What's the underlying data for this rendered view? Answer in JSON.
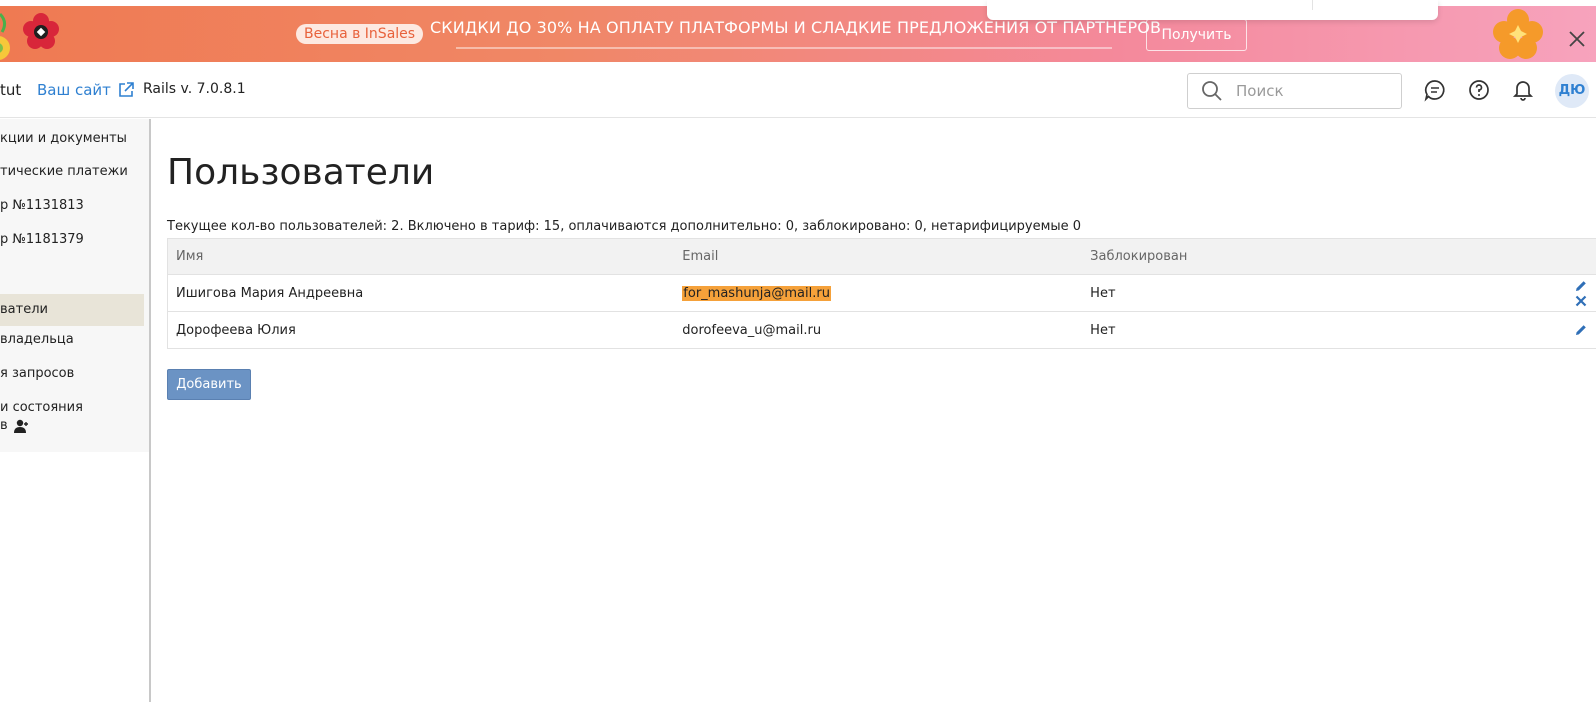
{
  "promo": {
    "badge": "Весна в InSales",
    "headline": "СКИДКИ ДО 30% НА ОПЛАТУ ПЛАТФОРМЫ И СЛАДКИЕ ПРЕДЛОЖЕНИЯ ОТ ПАРТНЕРОВ",
    "cta_label": "Получить"
  },
  "header": {
    "shop_name": "tut",
    "site_link_label": "Ваш сайт",
    "rails_version": "Rails v. 7.0.8.1",
    "search_placeholder": "Поиск",
    "avatar_initials": "ДЮ"
  },
  "sidebar": {
    "items": [
      {
        "label": "кции и документы",
        "active": false
      },
      {
        "label": "тические платежи",
        "active": false
      },
      {
        "label": "р №1131813",
        "active": false
      },
      {
        "label": "р №1181379",
        "active": false
      },
      {
        "label": "ватели",
        "active": true
      },
      {
        "label": "владельца",
        "active": false
      },
      {
        "label": "я запросов",
        "active": false
      },
      {
        "label": "и состояния",
        "active": false
      },
      {
        "label": "в",
        "active": false
      }
    ]
  },
  "main": {
    "title": "Пользователи",
    "summary": "Текущее кол-во пользователей: 2. Включено в тариф: 15, оплачиваются дополнительно: 0, заблокировано: 0, нетарифицируемые 0",
    "table": {
      "columns": [
        "Имя",
        "Email",
        "Заблокирован"
      ],
      "rows": [
        {
          "name": "Ишигова Мария Андреевна",
          "email": "for_mashunja@mail.ru",
          "blocked": "Нет"
        },
        {
          "name": "Дорофеева Юлия",
          "email": "dorofeeva_u@mail.ru",
          "blocked": "Нет"
        }
      ]
    },
    "add_label": "Добавить"
  },
  "colors": {
    "link": "#2f80d1",
    "active_sidebar": "#e8e4d8",
    "email_highlight": "#f5a13a",
    "add_button": "#6b93c4"
  },
  "icons": {
    "external_link": "external-link-icon",
    "search": "search-icon",
    "chat": "chat-icon",
    "help": "help-icon",
    "bell": "bell-icon",
    "edit": "pencil-icon",
    "delete": "close-icon",
    "person": "person-icon"
  }
}
